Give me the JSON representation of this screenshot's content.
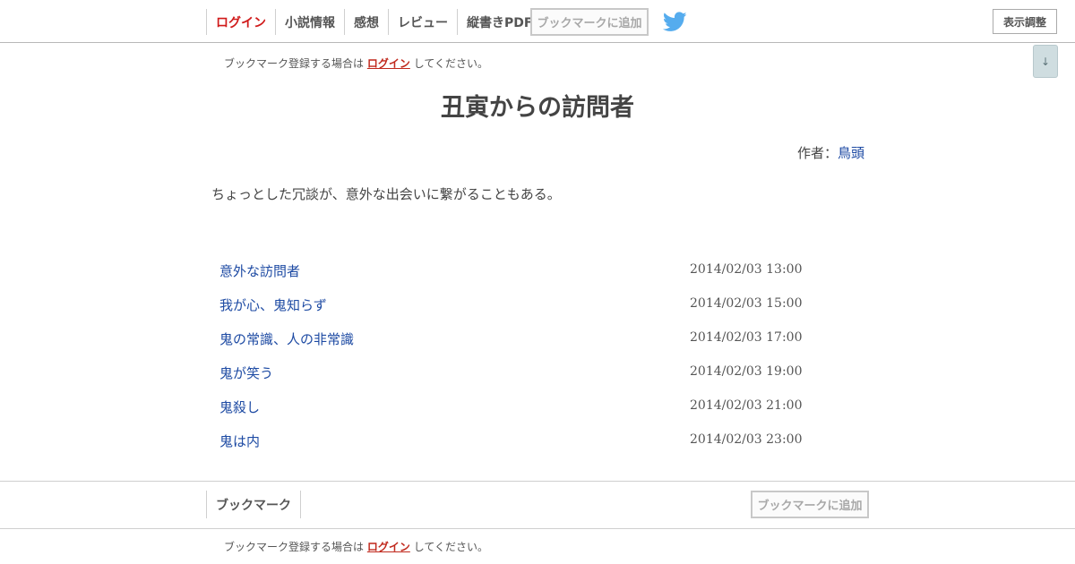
{
  "nav": {
    "login": "ログイン",
    "novel_info": "小説情報",
    "impressions": "感想",
    "review": "レビュー",
    "vertical_pdf": "縦書きPDF",
    "add_bookmark": "ブックマークに追加",
    "display_adjust": "表示調整",
    "scroll_down": "↓"
  },
  "notice": {
    "prefix": "ブックマーク登録する場合は",
    "link": "ログイン",
    "suffix": "してください。"
  },
  "novel": {
    "title": "丑寅からの訪問者",
    "author_label": "作者：",
    "author_name": "鳥頭",
    "summary": "ちょっとした冗談が、意外な出会いに繋がることもある。"
  },
  "chapters": [
    {
      "title": "意外な訪問者",
      "date": "2014/02/03 13:00"
    },
    {
      "title": "我が心、鬼知らず",
      "date": "2014/02/03 15:00"
    },
    {
      "title": "鬼の常識、人の非常識",
      "date": "2014/02/03 17:00"
    },
    {
      "title": "鬼が笑う",
      "date": "2014/02/03 19:00"
    },
    {
      "title": "鬼殺し",
      "date": "2014/02/03 21:00"
    },
    {
      "title": "鬼は内",
      "date": "2014/02/03 23:00"
    }
  ],
  "footer": {
    "bookmark": "ブックマーク",
    "add_bookmark": "ブックマークに追加",
    "notice_prefix": "ブックマーク登録する場合は",
    "notice_link": "ログイン",
    "notice_suffix": "してください。"
  },
  "colors": {
    "login_red": "#d01a1a",
    "link_blue": "#1d4aa3",
    "twitter_blue": "#55acee"
  },
  "icons": {
    "twitter": "twitter-bird-icon",
    "scroll_down": "down-arrow-icon"
  }
}
